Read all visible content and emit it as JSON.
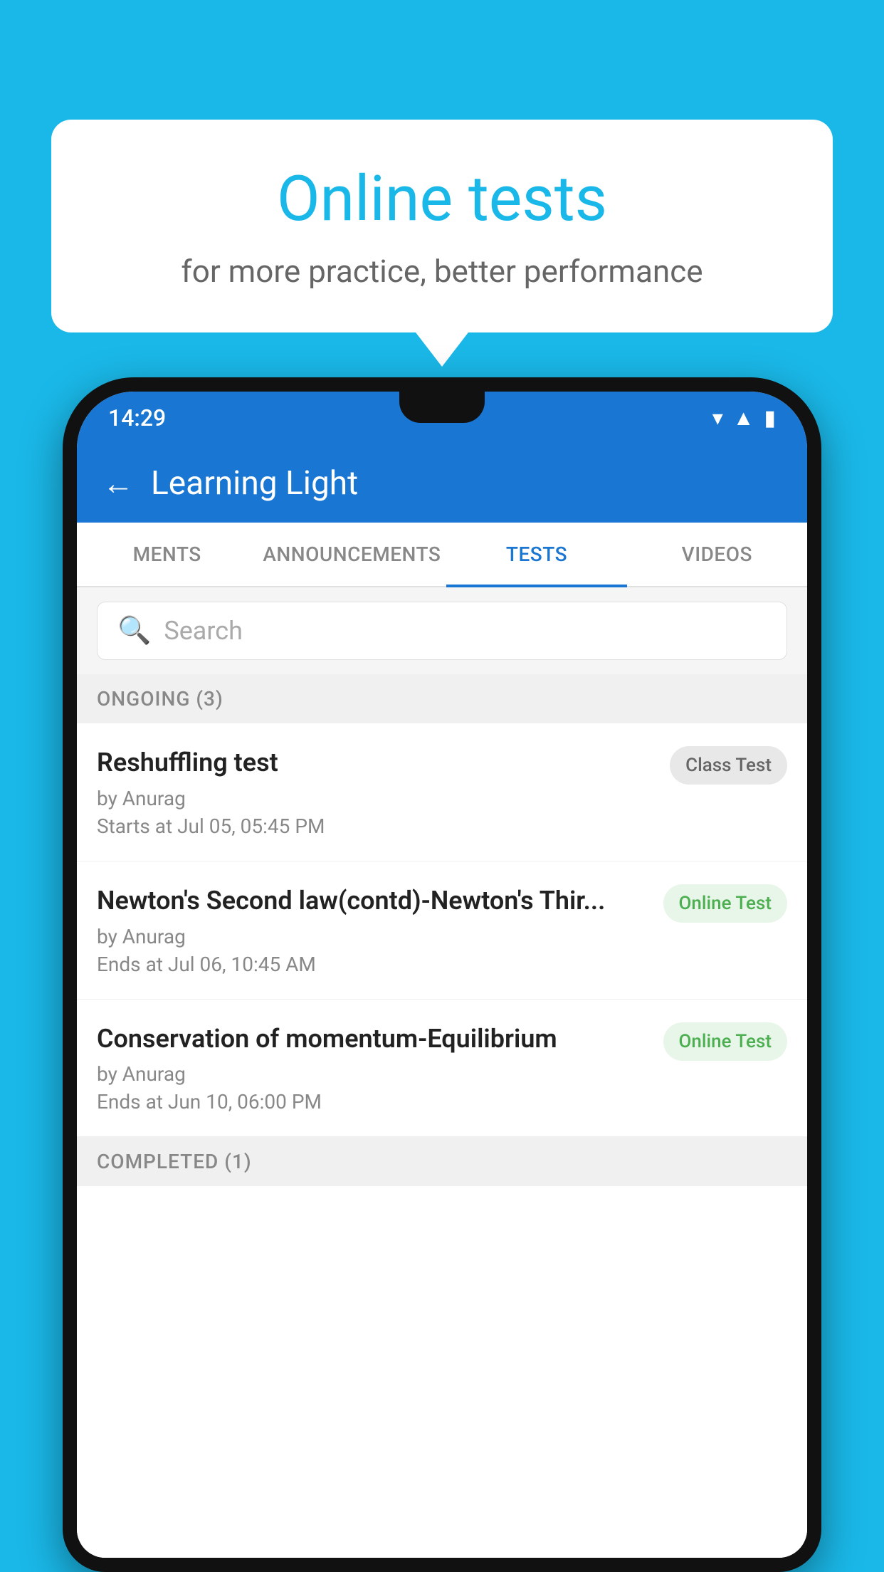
{
  "background_color": "#1ab8e8",
  "bubble": {
    "title": "Online tests",
    "subtitle": "for more practice, better performance"
  },
  "phone": {
    "status_bar": {
      "time": "14:29",
      "icons": [
        "wifi",
        "signal",
        "battery"
      ]
    },
    "header": {
      "back_label": "←",
      "title": "Learning Light"
    },
    "tabs": [
      {
        "label": "MENTS",
        "active": false
      },
      {
        "label": "ANNOUNCEMENTS",
        "active": false
      },
      {
        "label": "TESTS",
        "active": true
      },
      {
        "label": "VIDEOS",
        "active": false
      }
    ],
    "search": {
      "placeholder": "Search"
    },
    "ongoing_section": {
      "label": "ONGOING (3)"
    },
    "test_items": [
      {
        "name": "Reshuffling test",
        "by": "by Anurag",
        "time_label": "Starts at",
        "time": "Jul 05, 05:45 PM",
        "badge": "Class Test",
        "badge_type": "class"
      },
      {
        "name": "Newton's Second law(contd)-Newton's Thir...",
        "by": "by Anurag",
        "time_label": "Ends at",
        "time": "Jul 06, 10:45 AM",
        "badge": "Online Test",
        "badge_type": "online"
      },
      {
        "name": "Conservation of momentum-Equilibrium",
        "by": "by Anurag",
        "time_label": "Ends at",
        "time": "Jun 10, 06:00 PM",
        "badge": "Online Test",
        "badge_type": "online"
      }
    ],
    "completed_section": {
      "label": "COMPLETED (1)"
    }
  }
}
